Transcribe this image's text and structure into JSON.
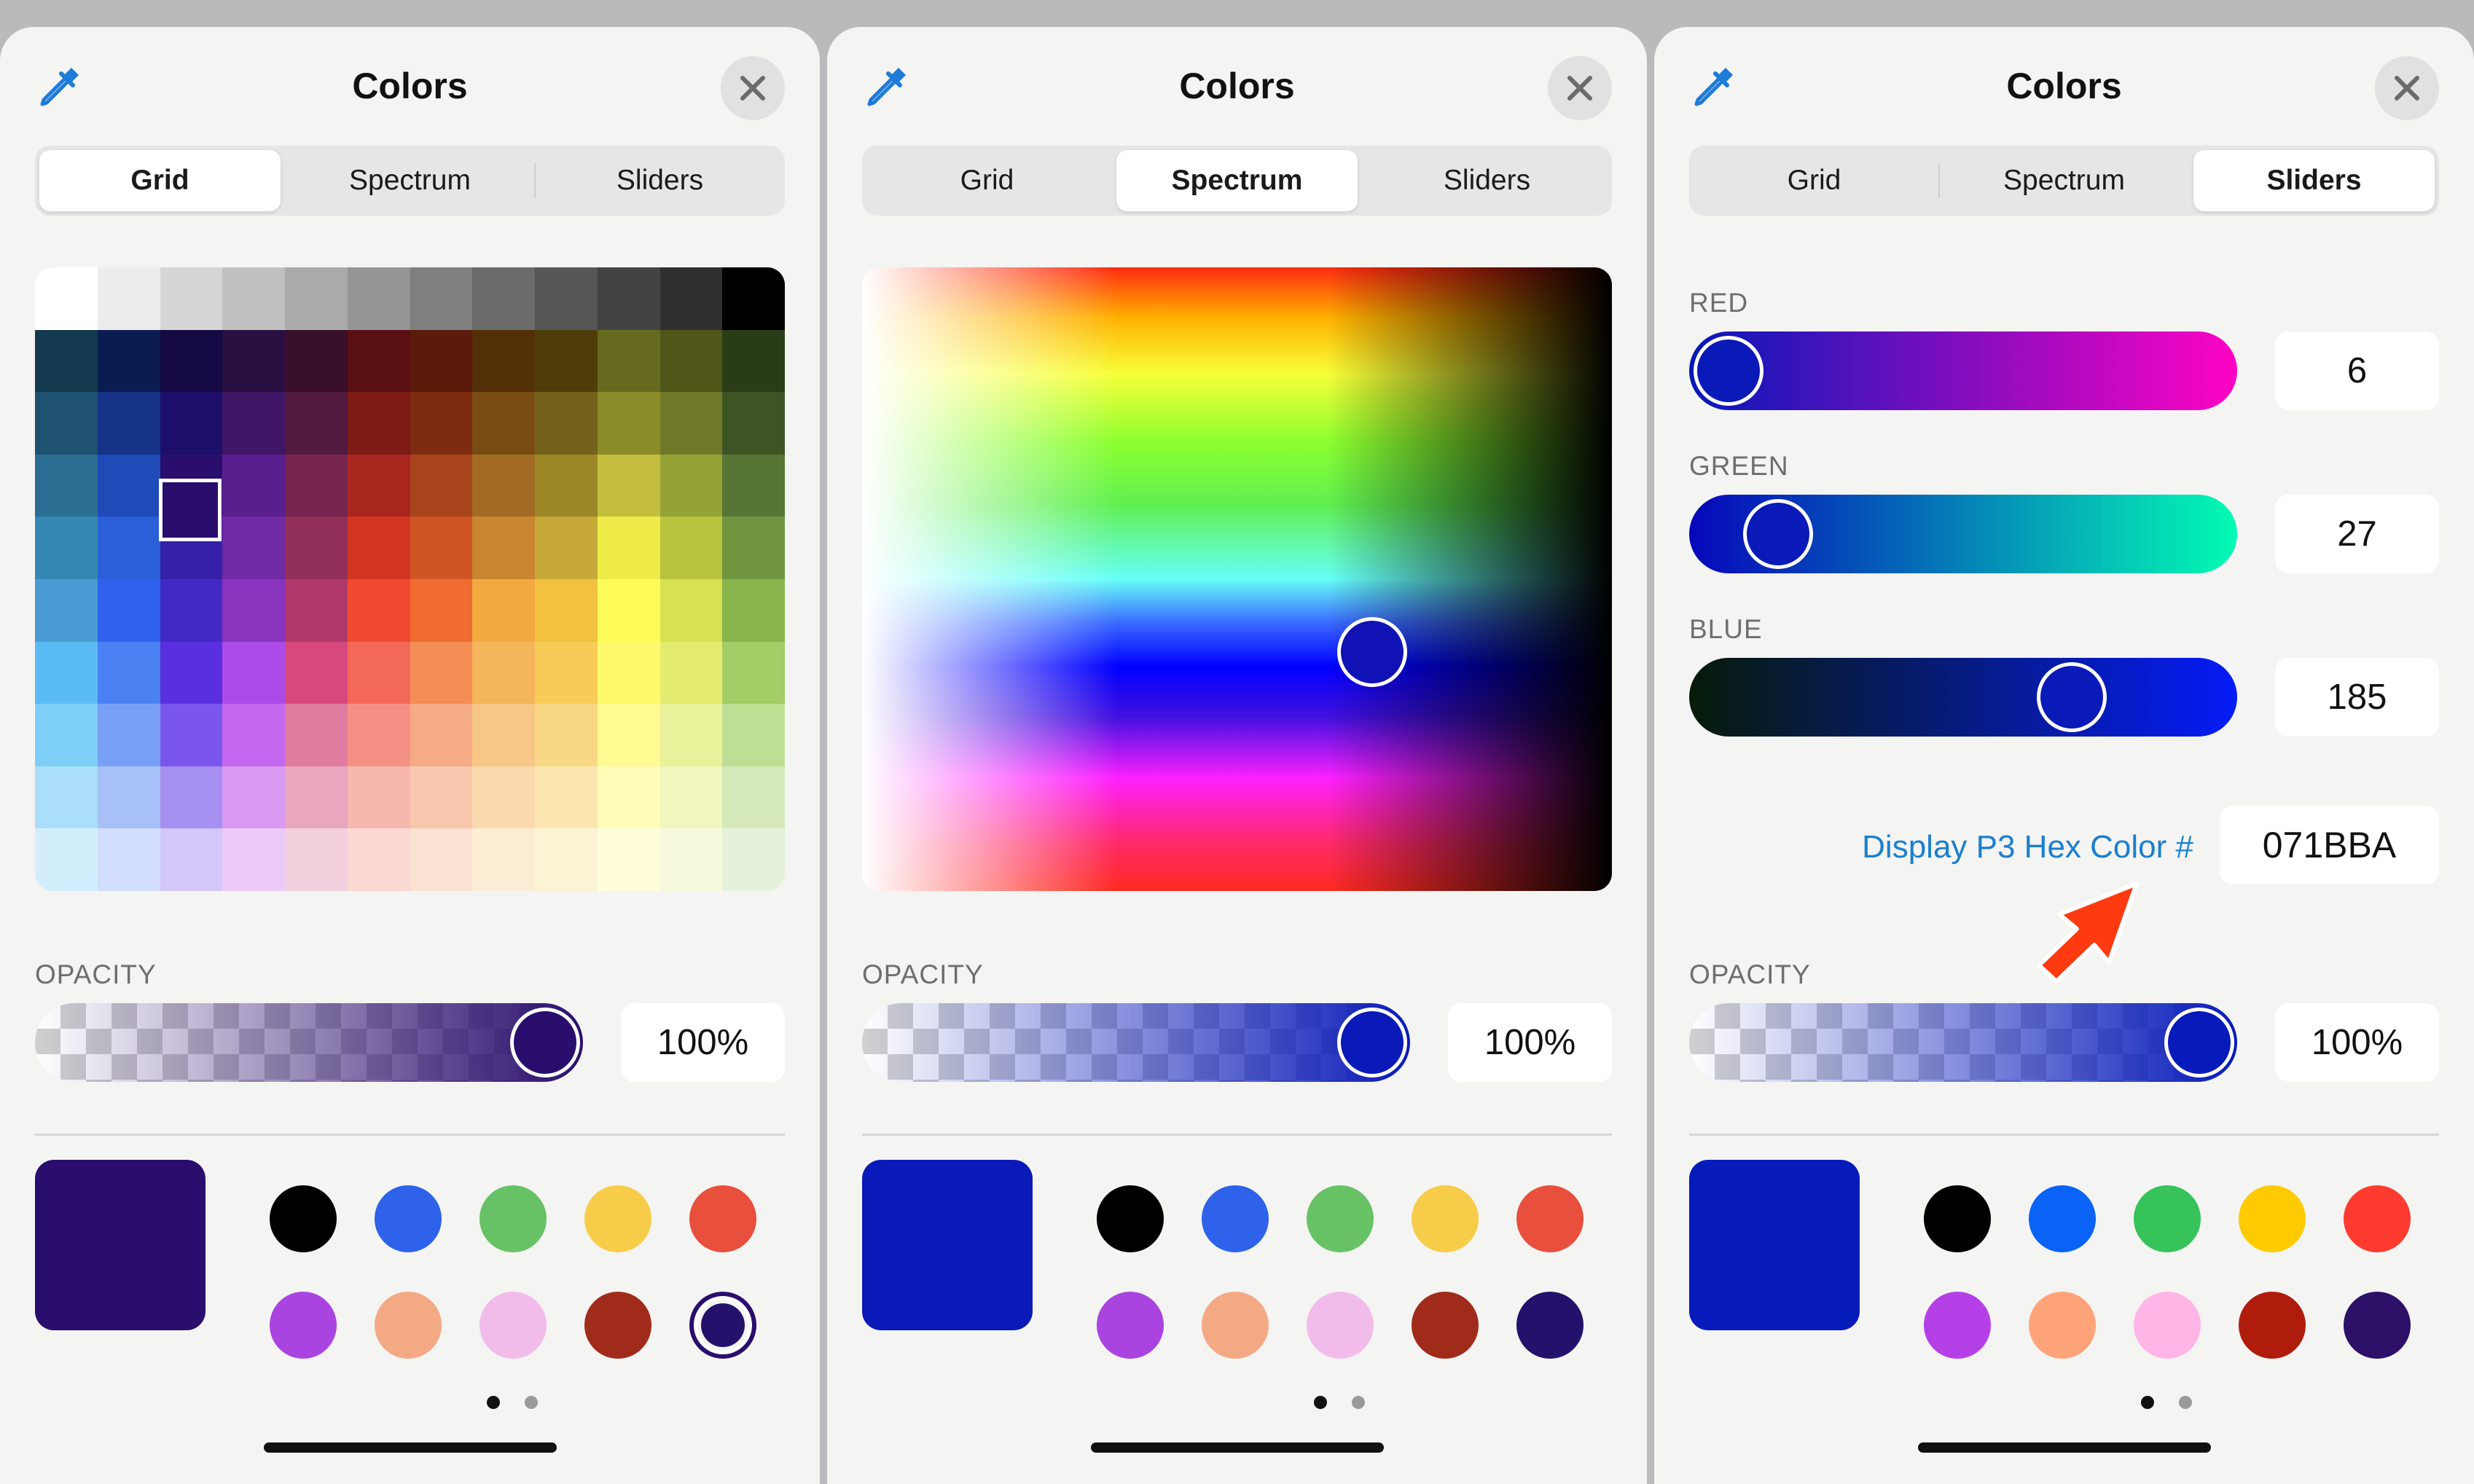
{
  "title": "Colors",
  "tabs": [
    "Grid",
    "Spectrum",
    "Sliders"
  ],
  "opacity_label": "OPACITY",
  "panels": [
    {
      "id": "grid",
      "active_tab": 0,
      "opacity_value": "100%",
      "opacity_level": 1.0,
      "current_color": "#2a0e6e"
    },
    {
      "id": "spectrum",
      "active_tab": 1,
      "opacity_value": "100%",
      "opacity_level": 1.0,
      "current_color": "#0a1ab8"
    },
    {
      "id": "sliders",
      "active_tab": 2,
      "opacity_value": "100%",
      "opacity_level": 1.0,
      "current_color": "#071bba"
    }
  ],
  "sliders": {
    "red": {
      "label": "RED",
      "value": "6"
    },
    "green": {
      "label": "GREEN",
      "value": "27"
    },
    "blue": {
      "label": "BLUE",
      "value": "185"
    }
  },
  "hex": {
    "label": "Display P3 Hex Color #",
    "value": "071BBA"
  },
  "grid_colors": [
    [
      "#ffffff",
      "#ececec",
      "#d6d6d6",
      "#c0c0c0",
      "#aaaaaa",
      "#959595",
      "#7f7f7f",
      "#6b6b6b",
      "#565656",
      "#434343",
      "#303030",
      "#000000"
    ],
    [
      "#133a4e",
      "#0b1c52",
      "#150a45",
      "#2a0f42",
      "#3a0f2a",
      "#5a0f12",
      "#5b1a0a",
      "#543008",
      "#4f3d09",
      "#666a1f",
      "#4f5618",
      "#2a3c17"
    ],
    [
      "#1f5270",
      "#143286",
      "#1d0f6a",
      "#3f1566",
      "#521a3f",
      "#7e1b15",
      "#7e2c10",
      "#784c12",
      "#74611a",
      "#8a8c2a",
      "#6e7827",
      "#3e5424"
    ],
    [
      "#2b6e94",
      "#1e4bb8",
      "#2a0e6e",
      "#5a1f8e",
      "#77244f",
      "#a9261e",
      "#a8441b",
      "#a26c24",
      "#9d8728",
      "#c4be3e",
      "#94a236",
      "#557634"
    ],
    [
      "#3588b3",
      "#2a5fd8",
      "#3620a8",
      "#6f2aa4",
      "#922f59",
      "#d23622",
      "#d05524",
      "#c98631",
      "#c6a938",
      "#efeb49",
      "#b8c43e",
      "#6f963f"
    ],
    [
      "#4a9bd3",
      "#2f61ec",
      "#4329c4",
      "#8933bf",
      "#b1386a",
      "#ef4a30",
      "#f06c30",
      "#f2a940",
      "#f1c13f",
      "#fffb58",
      "#d7e153",
      "#88b54b"
    ],
    [
      "#5bbcf5",
      "#4b82f3",
      "#5a2fe0",
      "#ac4be8",
      "#d6487e",
      "#f36957",
      "#f48e55",
      "#f5b55a",
      "#f6cc56",
      "#fff96e",
      "#e3ec6f",
      "#a3cd67"
    ],
    [
      "#7ecff8",
      "#7aa0f5",
      "#7b56ed",
      "#c568f0",
      "#e07c9f",
      "#f49184",
      "#f5ab86",
      "#f7c785",
      "#f8d885",
      "#fffa92",
      "#eaf19b",
      "#bddf94"
    ],
    [
      "#aadef9",
      "#a8c0f8",
      "#a690f2",
      "#d99af3",
      "#e9a6bf",
      "#f6b7ae",
      "#f8c7ad",
      "#f9d9ad",
      "#fae6ae",
      "#fffbb9",
      "#f1f5be",
      "#d5e9bb"
    ],
    [
      "#d2eefc",
      "#d2defb",
      "#d3c6f8",
      "#ebcaf8",
      "#f2d0de",
      "#fad8d3",
      "#fbe2d2",
      "#fcecd4",
      "#fcf2d4",
      "#fffdda",
      "#f7f9dd",
      "#e6f1dc"
    ]
  ],
  "favorites_standard": [
    "#000000",
    "#2e62ea",
    "#67c266",
    "#f7cc48",
    "#e84f3d",
    "#a944e0",
    "#f4a985",
    "#f2bcea",
    "#a12b1b",
    "#23116c"
  ],
  "favorites_system": [
    "#000000",
    "#0a63f6",
    "#35c35a",
    "#fecb00",
    "#ff3b30",
    "#b540e8",
    "#ffa37a",
    "#ffb6e6",
    "#b01c0c",
    "#2d1068"
  ]
}
